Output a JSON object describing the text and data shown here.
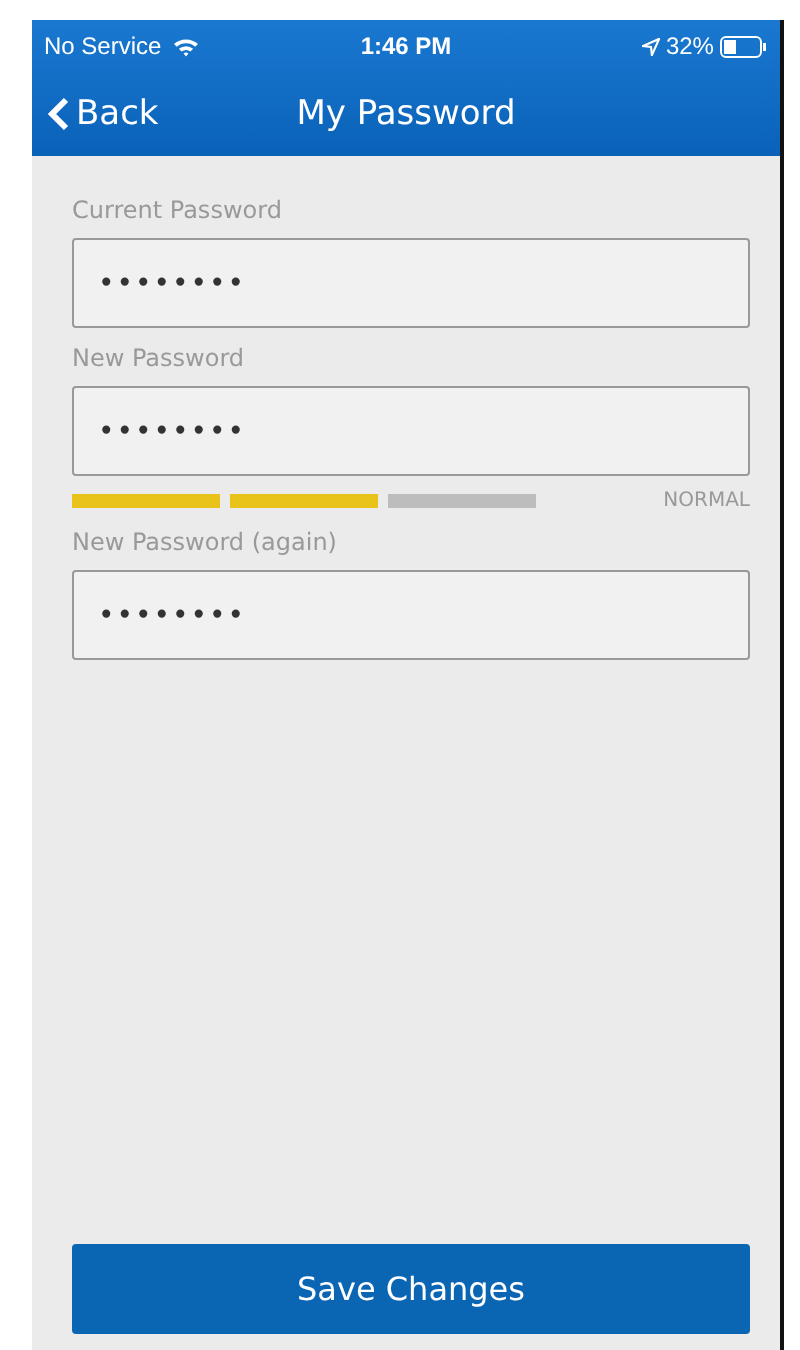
{
  "status_bar": {
    "carrier": "No Service",
    "time": "1:46 PM",
    "battery": "32%"
  },
  "nav": {
    "back": "Back",
    "title": "My Password"
  },
  "fields": [
    {
      "label": "Current Password",
      "value": "••••••••"
    },
    {
      "label": "New Password",
      "value": "••••••••",
      "strength": {
        "segments": [
          {
            "on": true
          },
          {
            "on": true
          },
          {
            "on": false
          }
        ],
        "text": "NORMAL"
      }
    },
    {
      "label": "New Password (again)",
      "value": "••••••••"
    }
  ],
  "save_button": "Save Changes"
}
